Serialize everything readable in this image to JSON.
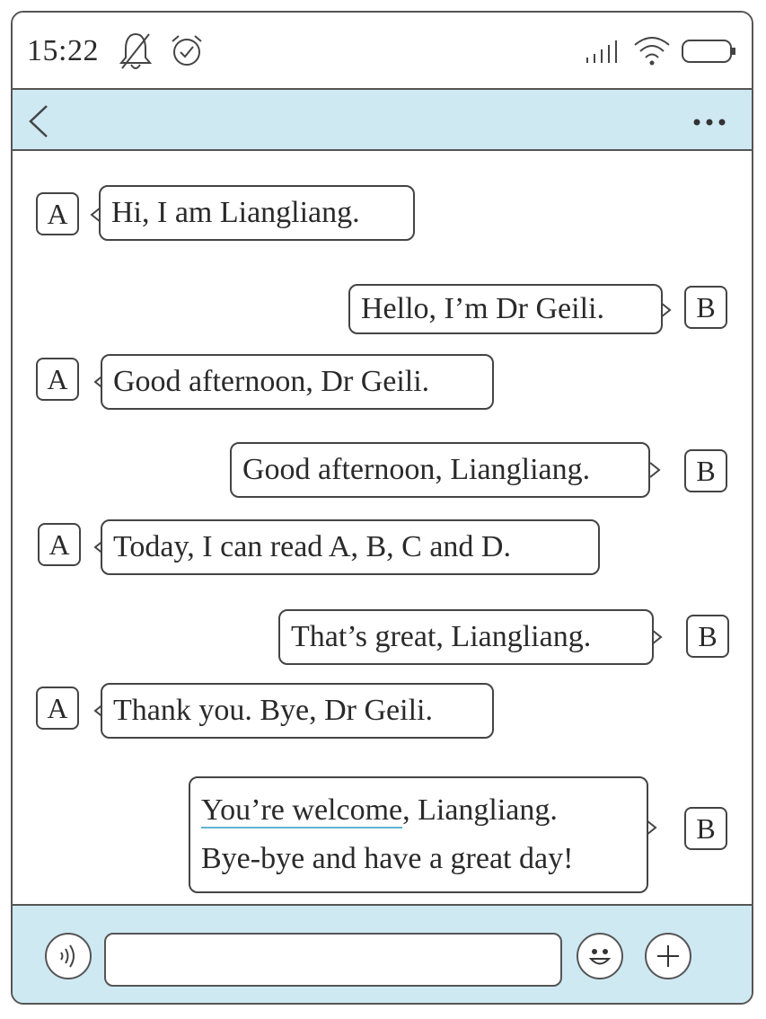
{
  "status_bar": {
    "time": "15:22",
    "icons": [
      "bell-muted-icon",
      "alarm-clock-icon",
      "signal-icon",
      "wifi-icon",
      "battery-icon"
    ]
  },
  "nav_bar": {
    "back_icon": "chevron-left-icon",
    "menu_icon": "more-dots-icon",
    "background_color": "#cfe9f3"
  },
  "messages": [
    {
      "speaker": "A",
      "text": "Hi, I am Liangliang."
    },
    {
      "speaker": "B",
      "text": "Hello, I’m Dr Geili."
    },
    {
      "speaker": "A",
      "text": "Good afternoon, Dr Geili."
    },
    {
      "speaker": "B",
      "text": "Good afternoon, Liangliang."
    },
    {
      "speaker": "A",
      "text": "Today, I can read A, B, C and D."
    },
    {
      "speaker": "B",
      "text": "That’s great, Liangliang."
    },
    {
      "speaker": "A",
      "text": "Thank you. Bye, Dr Geili."
    },
    {
      "speaker": "B",
      "line1_underlined": "You’re welcome",
      "line1_rest": ", Liangliang.",
      "line2": "Bye-bye and have a great day!"
    }
  ],
  "input_bar": {
    "icons": [
      "voice-icon",
      "emoji-icon",
      "plus-icon"
    ],
    "text_value": ""
  }
}
